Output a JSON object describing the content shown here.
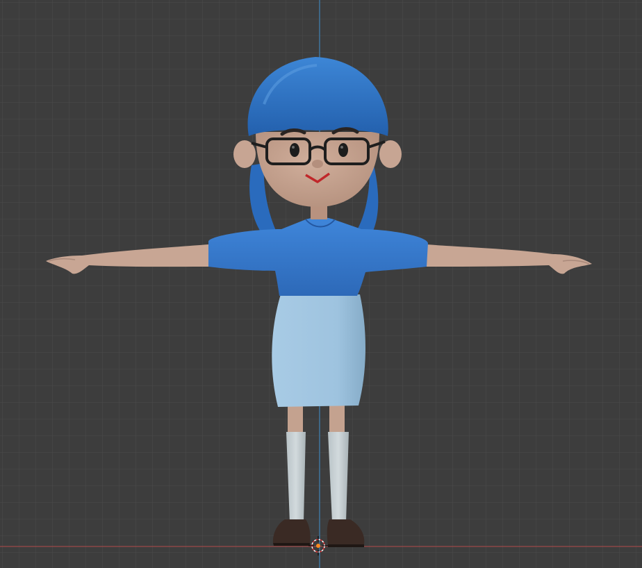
{
  "viewport": {
    "background_color": "#3d3d3d",
    "grid_color": "#4b4b4b",
    "axis_x_color": "#9b4a4a",
    "axis_z_color": "#3b7fb0",
    "cursor_color": "#ff8a1f"
  },
  "model": {
    "hair_color": "#2f74c4",
    "shirt_color": "#3478cf",
    "skirt_color": "#9ec3df",
    "skin_color": "#c7a593",
    "sock_color": "#c2ccd0",
    "shoe_color": "#3a2a24",
    "glasses_color": "#1e1e1e",
    "mouth_color": "#c0272a"
  }
}
